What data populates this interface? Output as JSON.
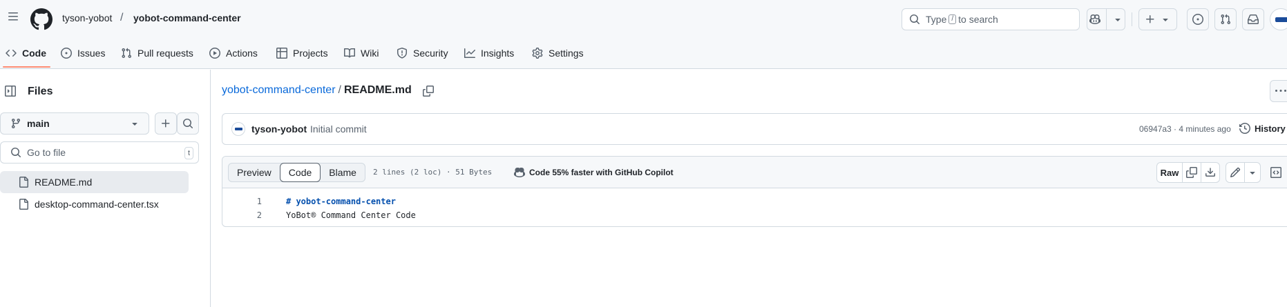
{
  "header": {
    "owner": "tyson-yobot",
    "separator": "/",
    "repo": "yobot-command-center",
    "search_prefix": "Type",
    "search_key": "/",
    "search_suffix": "to search"
  },
  "nav": {
    "tabs": [
      {
        "label": "Code",
        "icon": "code-icon"
      },
      {
        "label": "Issues",
        "icon": "issue-opened-icon"
      },
      {
        "label": "Pull requests",
        "icon": "git-pull-request-icon"
      },
      {
        "label": "Actions",
        "icon": "play-icon"
      },
      {
        "label": "Projects",
        "icon": "table-icon"
      },
      {
        "label": "Wiki",
        "icon": "book-icon"
      },
      {
        "label": "Security",
        "icon": "shield-icon"
      },
      {
        "label": "Insights",
        "icon": "graph-icon"
      },
      {
        "label": "Settings",
        "icon": "gear-icon"
      }
    ],
    "active_accent": "#fd8c73"
  },
  "sidebar": {
    "title": "Files",
    "branch": "main",
    "goto_placeholder": "Go to file",
    "goto_shortcut": "t",
    "files": [
      {
        "name": "README.md",
        "selected": true
      },
      {
        "name": "desktop-command-center.tsx",
        "selected": false
      }
    ]
  },
  "breadcrumb": {
    "repo": "yobot-command-center",
    "sep": "/",
    "file": "README.md"
  },
  "commit": {
    "author": "tyson-yobot",
    "message": "Initial commit",
    "meta": "06947a3 · 4 minutes ago",
    "history_label": "History"
  },
  "file": {
    "tabs": [
      "Preview",
      "Code",
      "Blame"
    ],
    "active_tab": "Code",
    "stats": "2 lines (2 loc) · 51 Bytes",
    "copilot": "Code 55% faster with GitHub Copilot",
    "raw_label": "Raw",
    "lines": [
      {
        "num": "1",
        "text": "# yobot-command-center"
      },
      {
        "num": "2",
        "text": "YoBot® Command Center Code"
      }
    ]
  },
  "colors": {
    "link": "#0969da",
    "header_bg": "#f6f8fa",
    "border": "#d1d9e0"
  }
}
